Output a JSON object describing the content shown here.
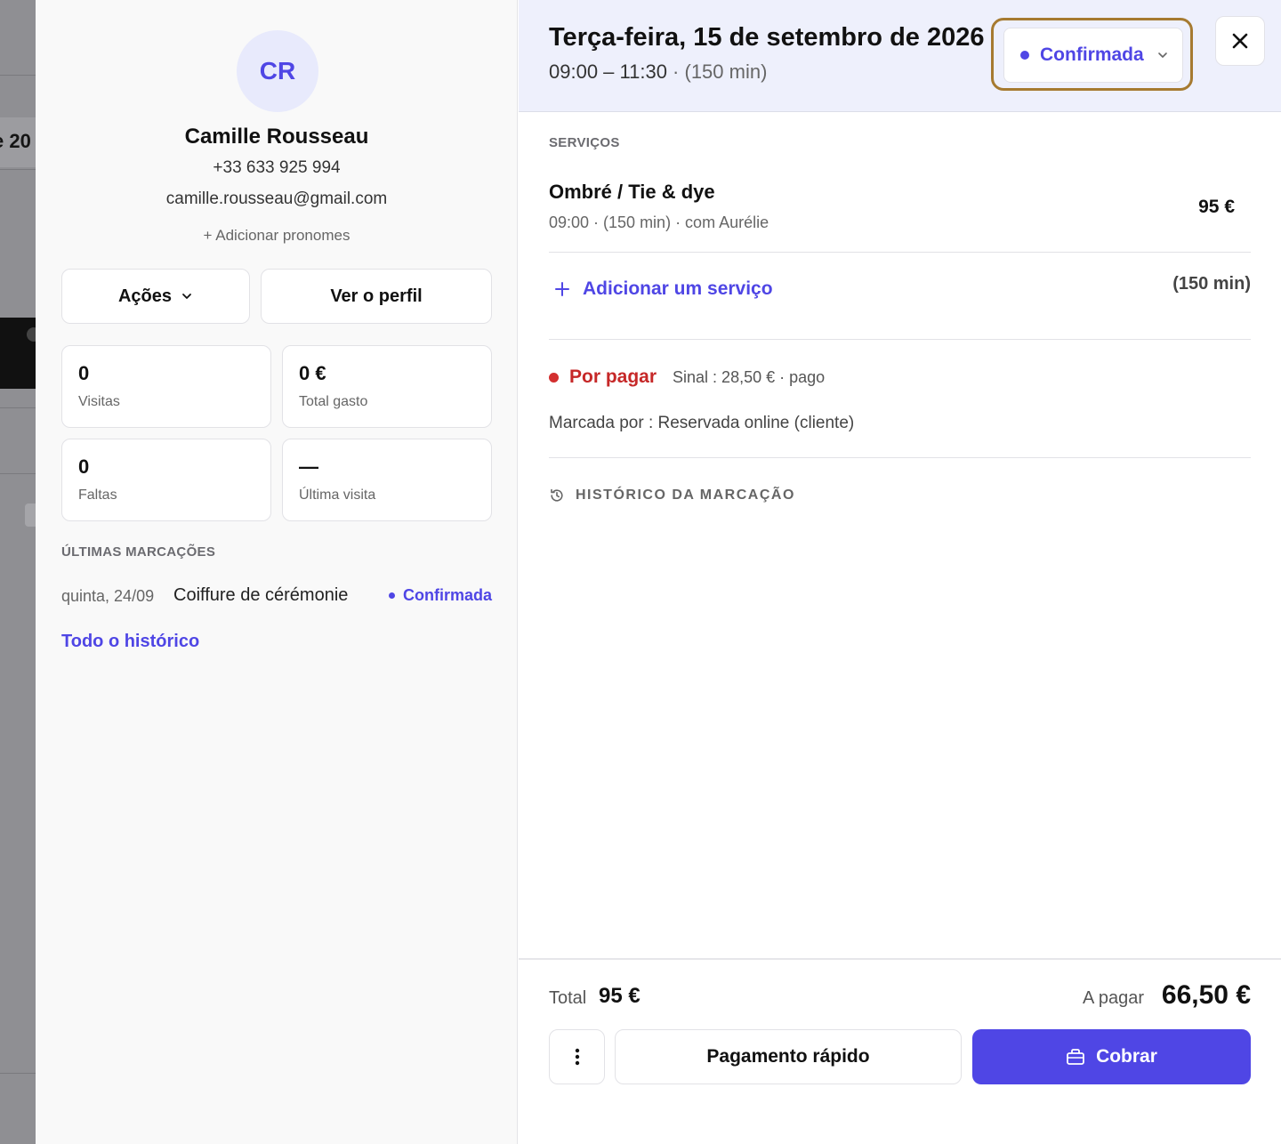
{
  "background": {
    "fragment_text": "e 20"
  },
  "client": {
    "initials": "CR",
    "name": "Camille Rousseau",
    "phone": "+33 633 925 994",
    "email": "camille.rousseau@gmail.com",
    "add_pronouns": "+ Adicionar pronomes",
    "actions_label": "Ações",
    "view_profile_label": "Ver o perfil",
    "stats": [
      {
        "value": "0",
        "label": "Visitas"
      },
      {
        "value": "0 €",
        "label": "Total gasto"
      },
      {
        "value": "0",
        "label": "Faltas"
      },
      {
        "value": "—",
        "label": "Última visita"
      }
    ],
    "recent_title": "ÚLTIMAS MARCAÇÕES",
    "recent": [
      {
        "date": "quinta, 24/09",
        "service": "Coiffure de cérémonie",
        "status": "Confirmada"
      }
    ],
    "history_link": "Todo o histórico"
  },
  "booking": {
    "date": "Terça-feira, 15 de setembro de 2026",
    "time": "09:00 – 11:30",
    "time_sep": " · ",
    "duration": "(150 min)",
    "status": "Confirmada",
    "close_label": "✕",
    "services_title": "SERVIÇOS",
    "services": [
      {
        "name": "Ombré / Tie & dye",
        "meta": "09:00 · (150 min) · com Aurélie",
        "price": "95 €"
      }
    ],
    "add_service": "Adicionar um serviço",
    "total_duration": "(150 min)",
    "payment_status": "Por pagar",
    "deposit": "Sinal : 28,50 € · pago",
    "booked_by": "Marcada por : Reservada online (cliente)",
    "history_toggle": "HISTÓRICO DA MARCAÇÃO"
  },
  "footer": {
    "total_label": "Total",
    "total_value": "95 €",
    "due_label": "A pagar",
    "due_value": "66,50 €",
    "quick_pay": "Pagamento rápido",
    "charge": "Cobrar"
  },
  "colors": {
    "accent": "#4f46e5",
    "header_bg": "#eef0fc",
    "unpaid": "#c62828",
    "focus_ring": "#a67a30"
  },
  "icons": {
    "chevron": "chevron-down-icon",
    "close": "close-icon",
    "history": "history-icon",
    "more": "kebab-menu-icon",
    "register": "register-icon",
    "plus": "plus-icon"
  }
}
